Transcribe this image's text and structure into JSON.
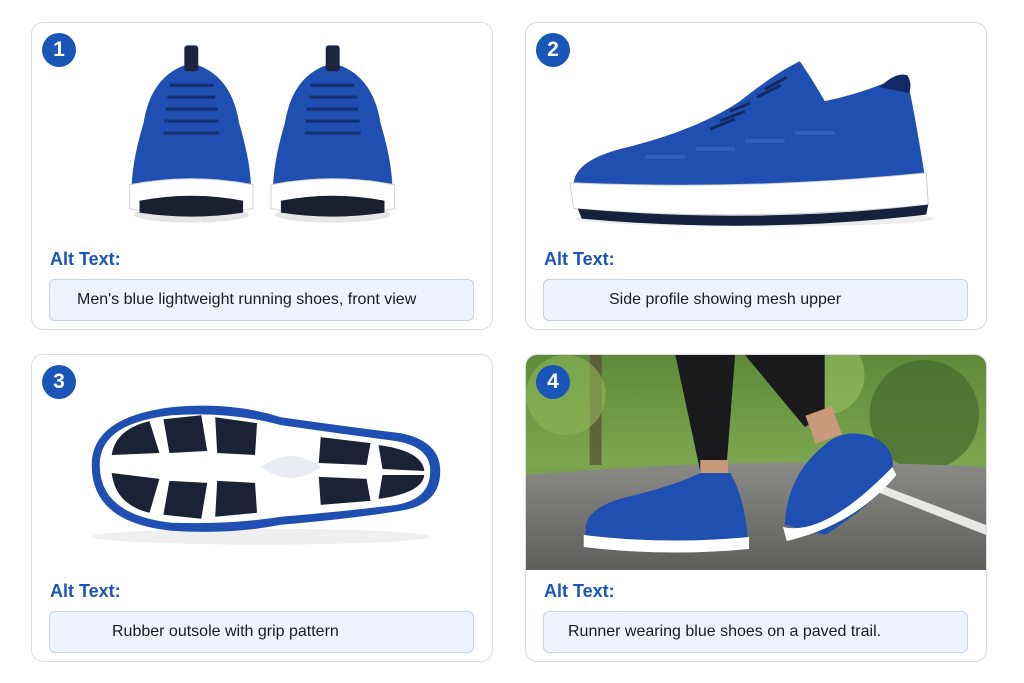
{
  "alt_heading": "Alt Text:",
  "cards": [
    {
      "number": "1",
      "image_icon": "shoes-front-view-image",
      "alt_text": "Men's blue lightweight running shoes, front view"
    },
    {
      "number": "2",
      "image_icon": "shoe-side-profile-image",
      "alt_text": "Side profile showing mesh upper"
    },
    {
      "number": "3",
      "image_icon": "shoe-outsole-image",
      "alt_text": "Rubber outsole with grip pattern"
    },
    {
      "number": "4",
      "image_icon": "runner-on-trail-image",
      "alt_text": "Runner wearing blue shoes on a paved trail."
    }
  ],
  "colors": {
    "accent": "#1a56b8",
    "shoe_blue": "#1f4fb0",
    "alt_box_bg": "#eef3fd",
    "alt_box_border": "#c2d3ef"
  }
}
